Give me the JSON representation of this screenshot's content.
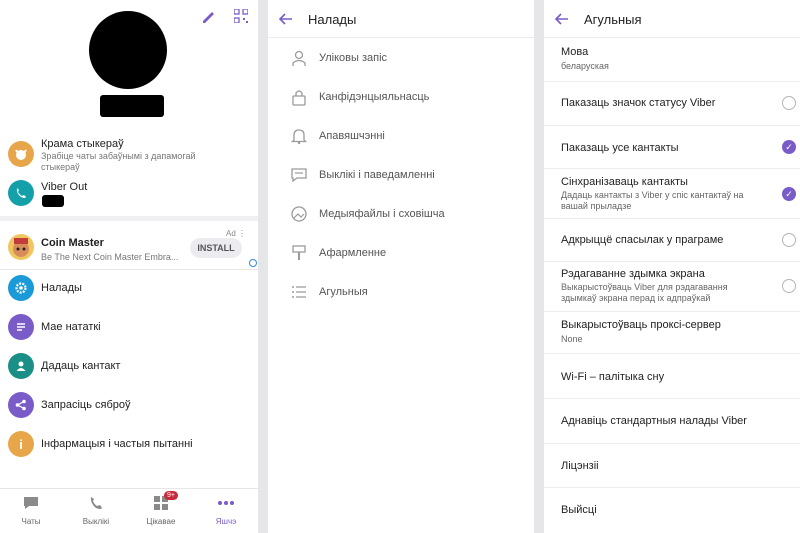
{
  "panel_more": {
    "menu": [
      {
        "icon": "sticker-store-icon",
        "title": "Крама стыкераў",
        "subtitle": "Зрабіце чаты забаўнымі з дапамогай стыкераў",
        "color": "#e8a64a"
      },
      {
        "icon": "viber-out-icon",
        "title": "Viber Out",
        "color": "#14a0a8"
      }
    ],
    "ad": {
      "title": "Coin Master",
      "subtitle": "Be The Next Coin Master Embra...",
      "button": "INSTALL",
      "ad_label": "Ad ⋮"
    },
    "items": [
      {
        "icon": "gear-icon",
        "label": "Налады",
        "color": "#1a9ad6"
      },
      {
        "icon": "notes-icon",
        "label": "Мае нататкі",
        "color": "#7a5cc9"
      },
      {
        "icon": "add-contact-icon",
        "label": "Дадаць кантакт",
        "color": "#1a8f86"
      },
      {
        "icon": "share-icon",
        "label": "Запрасіць сяброў",
        "color": "#7a5cc9"
      },
      {
        "icon": "info-icon",
        "label": "Інфармацыя і частыя пытанні",
        "color": "#e8a64a"
      }
    ],
    "nav": [
      {
        "icon": "chats-icon",
        "label": "Чаты"
      },
      {
        "icon": "calls-icon",
        "label": "Выклікі"
      },
      {
        "icon": "explore-icon",
        "label": "Цікавае",
        "badge": "9+"
      },
      {
        "icon": "more-icon",
        "label": "Яшчэ"
      }
    ]
  },
  "panel_settings": {
    "title": "Налады",
    "items": [
      {
        "icon": "account-icon",
        "label": "Уліковы запіс"
      },
      {
        "icon": "lock-icon",
        "label": "Канфідэнцыяльнасць"
      },
      {
        "icon": "bell-icon",
        "label": "Апавяшчэнні"
      },
      {
        "icon": "message-icon",
        "label": "Выклікі і паведамленні"
      },
      {
        "icon": "media-icon",
        "label": "Медыяфайлы і сховішча"
      },
      {
        "icon": "brush-icon",
        "label": "Афармленне"
      },
      {
        "icon": "list-icon",
        "label": "Агульныя"
      }
    ]
  },
  "panel_general": {
    "title": "Агульныя",
    "rows": [
      {
        "title": "Мова",
        "subtitle": "беларуская",
        "control": "none"
      },
      {
        "title": "Паказаць значок статусу Viber",
        "control": "radio",
        "checked": false
      },
      {
        "title": "Паказаць усе кантакты",
        "control": "check",
        "checked": true
      },
      {
        "title": "Сінхранізаваць кантакты",
        "subtitle": "Дадаць кантакты з Viber у спіс кантактаў на вашай прыладзе",
        "control": "check",
        "checked": true
      },
      {
        "title": "Адкрыццё спасылак у праграме",
        "control": "radio",
        "checked": false
      },
      {
        "title": "Рэдагаванне здымка экрана",
        "subtitle": "Выкарыстоўваць Viber для рэдагавання здымкаў экрана перад іх адпраўкай",
        "control": "radio",
        "checked": false
      },
      {
        "title": "Выкарыстоўваць проксі-сервер",
        "subtitle": "None",
        "control": "none"
      },
      {
        "title": "Wi-Fi – палітыка сну",
        "control": "none"
      },
      {
        "title": "Аднавіць стандартныя налады Viber",
        "control": "none"
      },
      {
        "title": "Ліцэнзіі",
        "control": "none"
      },
      {
        "title": "Выйсці",
        "control": "none"
      }
    ]
  },
  "accent": "#7a5cc9"
}
